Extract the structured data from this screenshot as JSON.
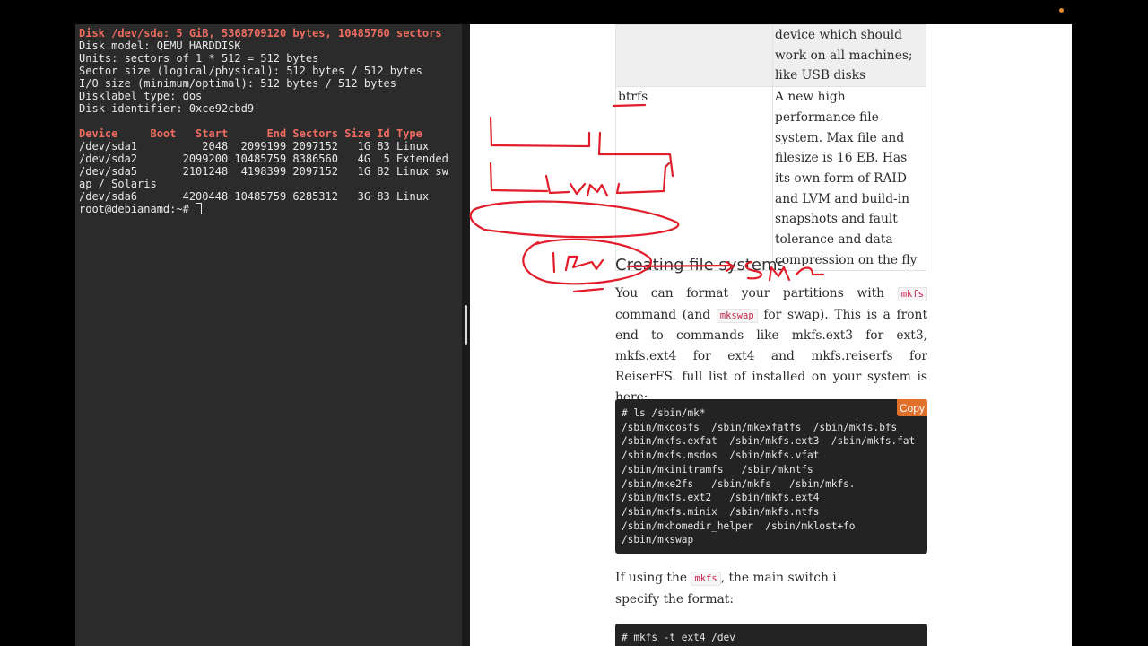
{
  "terminal": {
    "header_line": "Disk /dev/sda: 5 GiB, 5368709120 bytes, 10485760 sectors",
    "info_lines": [
      "Disk model: QEMU HARDDISK",
      "Units: sectors of 1 * 512 = 512 bytes",
      "Sector size (logical/physical): 512 bytes / 512 bytes",
      "I/O size (minimum/optimal): 512 bytes / 512 bytes",
      "Disklabel type: dos",
      "Disk identifier: 0xce92cbd9"
    ],
    "table_header": "Device     Boot   Start      End Sectors Size Id Type",
    "rows": [
      "/dev/sda1          2048  2099199 2097152   1G 83 Linux",
      "/dev/sda2       2099200 10485759 8386560   4G  5 Extended",
      "/dev/sda5       2101248  4198399 2097152   1G 82 Linux sw",
      "ap / Solaris",
      "/dev/sda6       4200448 10485759 6285312   3G 83 Linux"
    ],
    "prompt": "root@debianamd:~# "
  },
  "fs_table": {
    "rows": [
      {
        "name": "",
        "description": "device which should work on all machines; like USB disks"
      },
      {
        "name": "btrfs",
        "description": "A new high performance file system. Max file and filesize is 16 EB. Has its own form of RAID and LVM and build-in snapshots and fault tolerance and data compression on the fly"
      }
    ]
  },
  "section": {
    "heading": "Creating file systems",
    "intro": {
      "t1": "You can format your partitions with ",
      "c1": "mkfs",
      "t2": " command (and ",
      "c2": "mkswap",
      "t3": " for swap). This is a front end to commands like mkfs.ext3 for ext3, mkfs.ext4 for ext4 and mkfs.reiserfs for ReiserFS. full list of installed on your system is here:"
    },
    "code_lines": [
      "# ls /sbin/mk*",
      "/sbin/mkdosfs  /sbin/mkexfatfs  /sbin/mkfs.bfs",
      "/sbin/mkfs.exfat  /sbin/mkfs.ext3  /sbin/mkfs.fat",
      "/sbin/mkfs.msdos  /sbin/mkfs.vfat",
      "/sbin/mkinitramfs   /sbin/mkntfs",
      "/sbin/mke2fs   /sbin/mkfs   /sbin/mkfs.",
      "/sbin/mkfs.ext2   /sbin/mkfs.ext4",
      "/sbin/mkfs.minix  /sbin/mkfs.ntfs",
      "/sbin/mkhomedir_helper  /sbin/mklost+fo",
      "/sbin/mkswap"
    ],
    "copy_label": "Copy",
    "para2": {
      "t1": "If using the ",
      "c1": "mkfs",
      "t2": ", the main switch i",
      "t3": "specify the format:"
    },
    "code2": "# mkfs -t ext4 /dev"
  },
  "annotations": {
    "handwriting_1": "Lvm",
    "handwriting_2": "1 p",
    "handwriting_3": "Sm",
    "ink_color": "#e11d2a"
  },
  "colors": {
    "terminal_bg": "#2b2b2b",
    "terminal_red": "#ee6b5f",
    "code_bg": "#232323",
    "copy_button": "#e0702a",
    "inline_code": "#c7254e"
  }
}
